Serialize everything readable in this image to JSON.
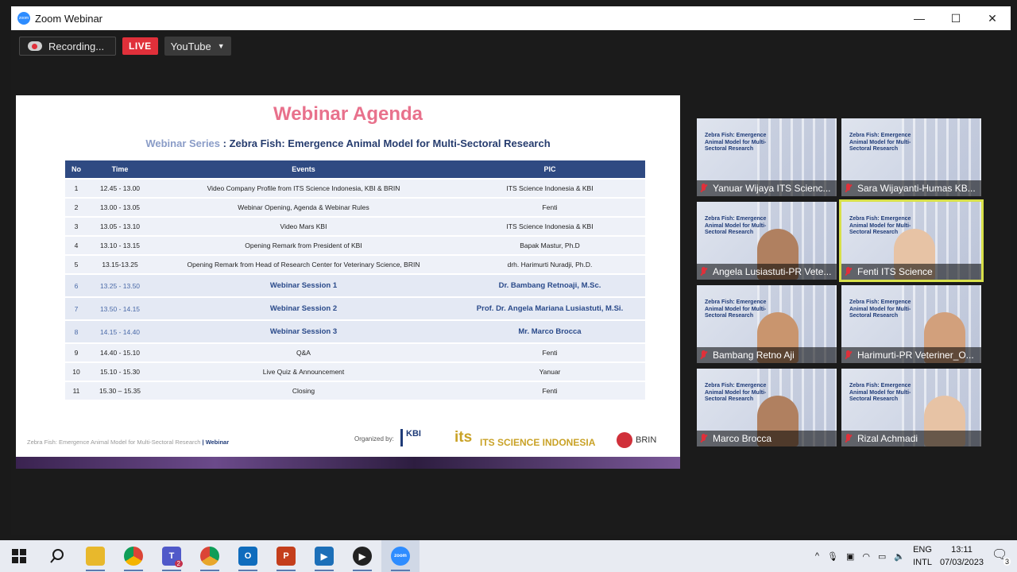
{
  "window": {
    "title": "Zoom Webinar",
    "minimize": "—",
    "maximize": "☐",
    "close": "✕"
  },
  "controls": {
    "recording": "Recording...",
    "live": "LIVE",
    "stream": "YouTube"
  },
  "slide": {
    "heading": "Webinar Agenda",
    "series_label": "Webinar Series",
    "series_title": ": Zebra Fish: Emergence Animal Model for Multi-Sectoral Research",
    "columns": [
      "No",
      "Time",
      "Events",
      "PIC"
    ],
    "rows": [
      {
        "no": "1",
        "time": "12.45 - 13.00",
        "event": "Video Company Profile from ITS Science Indonesia, KBI & BRIN",
        "pic": "ITS Science Indonesia & KBI"
      },
      {
        "no": "2",
        "time": "13.00 - 13.05",
        "event": "Webinar Opening, Agenda & Webinar Rules",
        "pic": "Fenti"
      },
      {
        "no": "3",
        "time": "13.05 - 13.10",
        "event": "Video Mars KBI",
        "pic": "ITS Science Indonesia & KBI"
      },
      {
        "no": "4",
        "time": "13.10 - 13.15",
        "event": "Opening Remark from President of KBI",
        "pic": "Bapak Mastur, Ph.D"
      },
      {
        "no": "5",
        "time": "13.15-13.25",
        "event": "Opening Remark from Head of Research Center for Veterinary Science, BRIN",
        "pic": "drh. Harimurti Nuradji, Ph.D."
      },
      {
        "no": "6",
        "time": "13.25 - 13.50",
        "event": "Webinar Session 1",
        "pic": "Dr. Bambang Retnoaji, M.Sc."
      },
      {
        "no": "7",
        "time": "13.50 - 14.15",
        "event": "Webinar Session 2",
        "pic": "Prof. Dr. Angela Mariana Lusiastuti, M.Si."
      },
      {
        "no": "8",
        "time": "14.15 - 14.40",
        "event": "Webinar Session 3",
        "pic": "Mr. Marco Brocca"
      },
      {
        "no": "9",
        "time": "14.40 - 15.10",
        "event": "Q&A",
        "pic": "Fenti"
      },
      {
        "no": "10",
        "time": "15.10 - 15.30",
        "event": "Live Quiz & Announcement",
        "pic": "Yanuar"
      },
      {
        "no": "11",
        "time": "15.30 – 15.35",
        "event": "Closing",
        "pic": "Fenti"
      }
    ],
    "footer_text": "Zebra Fish: Emergence Animal Model for Multi-Sectoral Research",
    "footer_tag": "| Webinar",
    "organized_by": "Organized by:",
    "logo_kbi": "KBI",
    "logo_its": "its",
    "logo_its_text": "ITS SCIENCE INDONESIA",
    "logo_brin": "BRIN"
  },
  "participants": [
    {
      "name": "Yanuar Wijaya ITS Scienc...",
      "active": false
    },
    {
      "name": "Sara Wijayanti-Humas KB...",
      "active": false
    },
    {
      "name": "Angela Lusiastuti-PR Vete...",
      "active": false
    },
    {
      "name": "Fenti ITS Science",
      "active": true
    },
    {
      "name": "Bambang Retno Aji",
      "active": false
    },
    {
      "name": "Harimurti-PR Veteriner_O...",
      "active": false
    },
    {
      "name": "Marco Brocca",
      "active": false
    },
    {
      "name": "Rizal Achmadi",
      "active": false
    }
  ],
  "tile_caption": "Zebra Fish: Emergence Animal Model for Multi-Sectoral Research",
  "taskbar": {
    "apps": [
      "start-icon",
      "search-icon",
      "file-explorer-icon",
      "chrome-icon",
      "teams-icon",
      "chrome-canary-icon",
      "outlook-icon",
      "powerpoint-icon",
      "media-player-icon",
      "video-icon",
      "zoom-icon"
    ],
    "teams_badge": "2",
    "lang1": "ENG",
    "lang2": "INTL",
    "time": "13:11",
    "date": "07/03/2023",
    "notifications": "3"
  }
}
